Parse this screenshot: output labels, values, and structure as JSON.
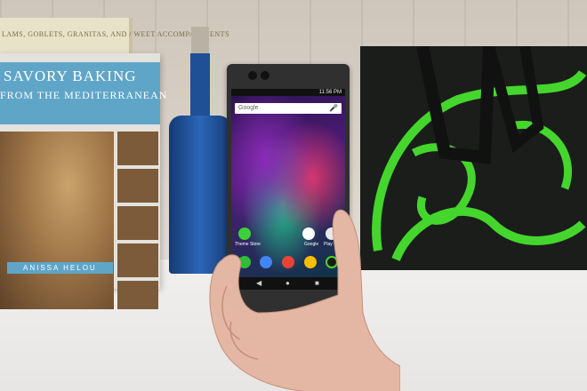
{
  "book_back": {
    "text": "LAMS, GOBLETS, GRANITAS, AND / WEET ACCOMPANIMENTS"
  },
  "book": {
    "title_line1": "SAVORY BAKING",
    "title_line2": "FROM THE MEDITERRANEAN",
    "author": "ANISSA HELOU"
  },
  "phone": {
    "status_time": "11:56 PM",
    "search_label": "Google",
    "apps_row1": [
      {
        "label": "Theme Store",
        "color": "#3bd13b"
      },
      {
        "label": "Google",
        "color": "#ffffff"
      },
      {
        "label": "Play Store",
        "color": "#e8e8e8"
      }
    ],
    "apps_dock": [
      {
        "label": "",
        "color": "#2fbd3a"
      },
      {
        "label": "",
        "color": "#4285f4"
      },
      {
        "label": "",
        "color": "#ea4335"
      },
      {
        "label": "",
        "color": "#fbbc05"
      },
      {
        "label": "",
        "color": "#44d62c"
      }
    ],
    "nav": [
      "◀",
      "●",
      "■"
    ]
  },
  "colors": {
    "razer_green": "#44d62c",
    "bag": "#1b1d1b",
    "bottle": "#1f4f94"
  }
}
